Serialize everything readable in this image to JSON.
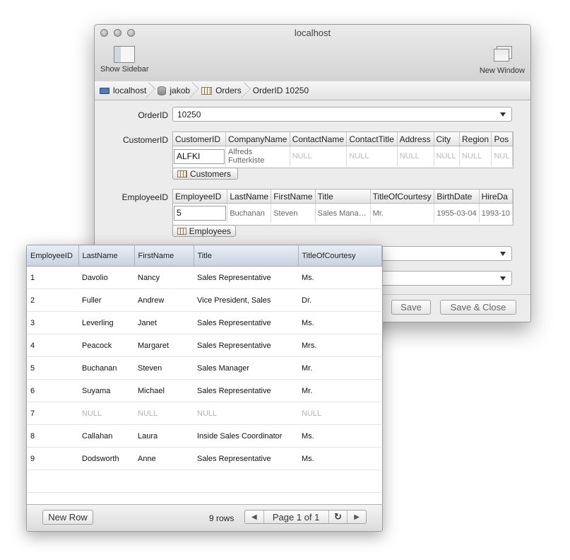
{
  "window": {
    "title": "localhost",
    "toolbar": {
      "show_sidebar": "Show Sidebar",
      "new_window": "New Window"
    }
  },
  "breadcrumb": [
    "localhost",
    "jakob",
    "Orders",
    "OrderID 10250"
  ],
  "form": {
    "order_label": "OrderID",
    "order_value": "10250",
    "customer_label": "CustomerID",
    "customer_columns": [
      "CustomerID",
      "CompanyName",
      "ContactName",
      "ContactTitle",
      "Address",
      "City",
      "Region",
      "Pos"
    ],
    "customer_row": [
      "ALFKI",
      "Alfreds Futterkiste",
      "NULL",
      "NULL",
      "NULL",
      "NULL",
      "NULL",
      "NUL"
    ],
    "customers_button": "Customers",
    "employee_label": "EmployeeID",
    "employee_columns": [
      "EmployeeID",
      "LastName",
      "FirstName",
      "Title",
      "TitleOfCourtesy",
      "BirthDate",
      "HireDa"
    ],
    "employee_row": [
      "5",
      "Buchanan",
      "Steven",
      "Sales Mana…",
      "Mr.",
      "1955-03-04",
      "1993-10"
    ],
    "employees_button": "Employees"
  },
  "buttons": {
    "save": "Save",
    "save_close": "Save & Close"
  },
  "popup": {
    "columns": [
      "EmployeeID",
      "LastName",
      "FirstName",
      "Title",
      "TitleOfCourtesy"
    ],
    "rows": [
      [
        "1",
        "Davolio",
        "Nancy",
        "Sales Representative",
        "Ms."
      ],
      [
        "2",
        "Fuller",
        "Andrew",
        "Vice President, Sales",
        "Dr."
      ],
      [
        "3",
        "Leverling",
        "Janet",
        "Sales Representative",
        "Ms."
      ],
      [
        "4",
        "Peacock",
        "Margaret",
        "Sales Representative",
        "Mrs."
      ],
      [
        "5",
        "Buchanan",
        "Steven",
        "Sales Manager",
        "Mr."
      ],
      [
        "6",
        "Suyama",
        "Michael",
        "Sales Representative",
        "Mr."
      ],
      [
        "7",
        "NULL",
        "NULL",
        "NULL",
        "NULL"
      ],
      [
        "8",
        "Callahan",
        "Laura",
        "Inside Sales Coordinator",
        "Ms."
      ],
      [
        "9",
        "Dodsworth",
        "Anne",
        "Sales Representative",
        "Ms."
      ]
    ],
    "new_row": "New Row",
    "row_count": "9 rows",
    "page_label": "Page 1 of 1",
    "prev_icon": "◀",
    "refresh_icon": "↻",
    "next_icon": "▶"
  }
}
